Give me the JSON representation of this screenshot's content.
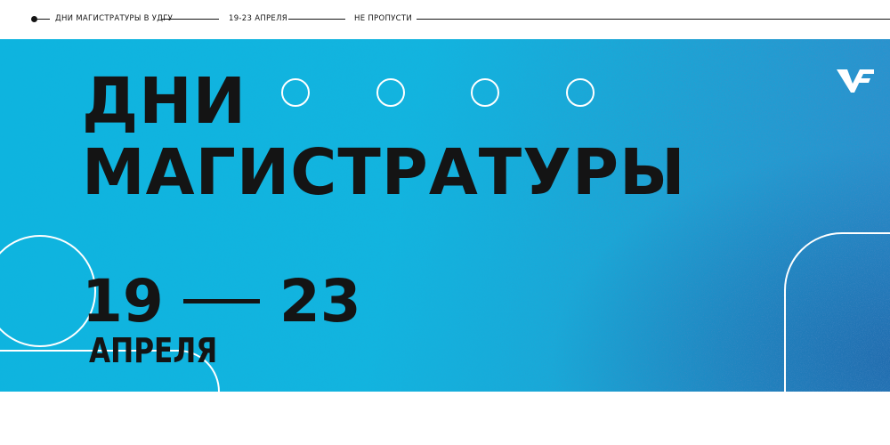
{
  "topbar": {
    "items": [
      "ДНИ МАГИСТРАТУРЫ В УДГУ",
      "19-23 АПРЕЛЯ",
      "НЕ ПРОПУСТИ"
    ]
  },
  "hero": {
    "title_line1": "ДНИ",
    "title_line2": "МАГИСТРАТУРЫ",
    "date_start": "19",
    "date_end": "23",
    "month": "АПРЕЛЯ",
    "logo_icon": "udgu-logo-icon"
  },
  "colors": {
    "background_blue": "#12b4df",
    "text_dark": "#141414",
    "white": "#ffffff"
  }
}
